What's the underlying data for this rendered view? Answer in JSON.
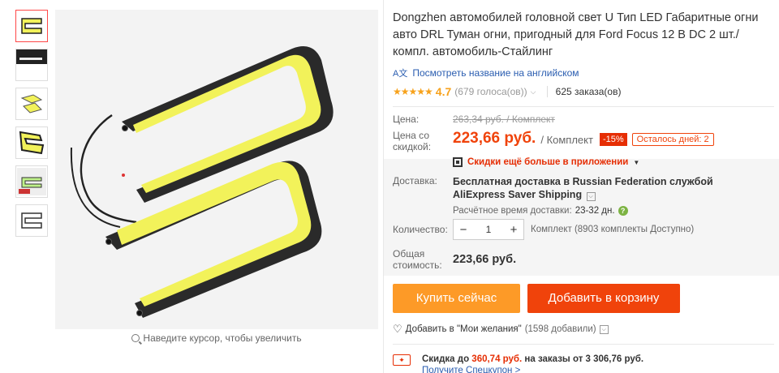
{
  "product": {
    "title": "Dongzhen автомобилей головной свет U Тип LED Габаритные огни авто DRL Туман огни, пригодный для Ford Focus 12 В DC 2 шт./компл. автомобиль-Стайлинг",
    "translate_label": "Посмотреть название на английском",
    "rating_value": "4.7",
    "votes": "(679 голоса(ов))",
    "orders": "625 заказа(ов)"
  },
  "gallery": {
    "zoom_hint": "Наведите курсор, чтобы увеличить",
    "thumbs": [
      "thumb-1",
      "thumb-2",
      "thumb-3",
      "thumb-4",
      "thumb-5",
      "thumb-6"
    ]
  },
  "price": {
    "price_label": "Цена:",
    "old_price": "263,34 руб. / Комплект",
    "discount_label": "Цена со скидкой:",
    "new_price": "223,66 руб.",
    "unit": "/ Комплект",
    "discount_badge": "-15%",
    "days_left": "Осталось дней: 2",
    "app_promo": "Скидки ещё больше в приложении"
  },
  "shipping": {
    "label": "Доставка:",
    "text_line1": "Бесплатная доставка в Russian Federation службой",
    "text_line2": "AliExpress Saver Shipping",
    "est_label": "Расчётное время доставки:",
    "est_days": "23-32 дн."
  },
  "quantity": {
    "label": "Количество:",
    "value": "1",
    "minus": "−",
    "plus": "+",
    "available": "Комплект (8903 комплекты Доступно)"
  },
  "total": {
    "label": "Общая стоимость:",
    "value": "223,66 руб."
  },
  "actions": {
    "buy_now": "Купить сейчас",
    "add_to_cart": "Добавить в корзину",
    "wishlist": "Добавить в \"Мои желания\"",
    "wishlist_count": "(1598 добавили)"
  },
  "coupon": {
    "prefix": "Скидка до ",
    "amount": "360,74 руб.",
    "suffix": " на заказы от 3 306,76 руб.",
    "link": "Получите Спецкупон >"
  },
  "colors": {
    "accent_orange": "#fd9a27",
    "accent_red": "#f0430b",
    "led_yellow": "#f2f25a"
  }
}
